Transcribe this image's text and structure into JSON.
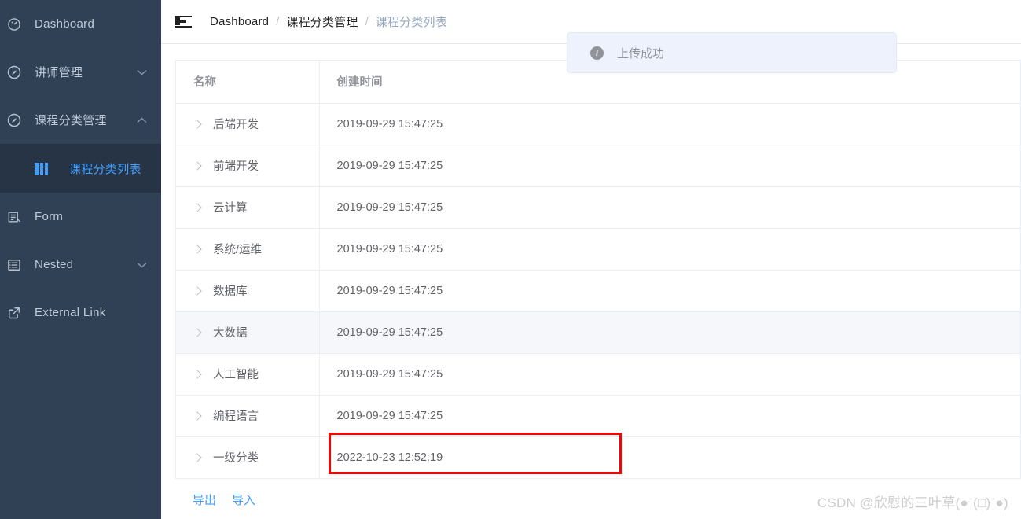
{
  "sidebar": {
    "bg_color": "#304156",
    "active_color": "#409EFF",
    "items": [
      {
        "label": "Dashboard",
        "icon": "dashboard-icon",
        "arrow": "",
        "active": false
      },
      {
        "label": "讲师管理",
        "icon": "compass-icon",
        "arrow": "chevron-down-icon",
        "active": false
      },
      {
        "label": "课程分类管理",
        "icon": "compass-icon",
        "arrow": "chevron-up-icon",
        "active": false
      },
      {
        "label": "Form",
        "icon": "form-icon",
        "arrow": "",
        "active": false
      },
      {
        "label": "Nested",
        "icon": "nested-list-icon",
        "arrow": "chevron-down-icon",
        "active": false
      },
      {
        "label": "External Link",
        "icon": "external-link-icon",
        "arrow": "",
        "active": false
      }
    ],
    "submenu": {
      "label": "课程分类列表",
      "icon": "grid-table-icon",
      "active": true
    }
  },
  "navbar": {
    "fold_icon": "hamburger-fold-icon",
    "breadcrumb": [
      {
        "label": "Dashboard",
        "current": false
      },
      {
        "label": "课程分类管理",
        "current": false
      },
      {
        "label": "课程分类列表",
        "current": true
      }
    ],
    "separator": "/"
  },
  "toast": {
    "icon": "info-circle-icon",
    "message": "上传成功",
    "bg_color": "#EDF2FC",
    "text_color": "#909399"
  },
  "table": {
    "columns": [
      {
        "key": "name",
        "label": "名称"
      },
      {
        "key": "created",
        "label": "创建时间"
      }
    ],
    "rows": [
      {
        "name": "后端开发",
        "created": "2019-09-29 15:47:25",
        "hovered": false,
        "highlighted": false
      },
      {
        "name": "前端开发",
        "created": "2019-09-29 15:47:25",
        "hovered": false,
        "highlighted": false
      },
      {
        "name": "云计算",
        "created": "2019-09-29 15:47:25",
        "hovered": false,
        "highlighted": false
      },
      {
        "name": "系统/运维",
        "created": "2019-09-29 15:47:25",
        "hovered": false,
        "highlighted": false
      },
      {
        "name": "数据库",
        "created": "2019-09-29 15:47:25",
        "hovered": false,
        "highlighted": false
      },
      {
        "name": "大数据",
        "created": "2019-09-29 15:47:25",
        "hovered": true,
        "highlighted": false
      },
      {
        "name": "人工智能",
        "created": "2019-09-29 15:47:25",
        "hovered": false,
        "highlighted": false
      },
      {
        "name": "编程语言",
        "created": "2019-09-29 15:47:25",
        "hovered": false,
        "highlighted": false
      },
      {
        "name": "一级分类",
        "created": "2022-10-23 12:52:19",
        "hovered": false,
        "highlighted": true
      }
    ],
    "expand_icon": "chevron-right-icon",
    "highlight_color": "#FF0000"
  },
  "footer_actions": [
    {
      "label": "导出",
      "name": "export-link"
    },
    {
      "label": "导入",
      "name": "import-link"
    }
  ],
  "watermark": {
    "text": "CSDN @欣慰的三叶草(●ˉ(□)ˉ●)"
  }
}
